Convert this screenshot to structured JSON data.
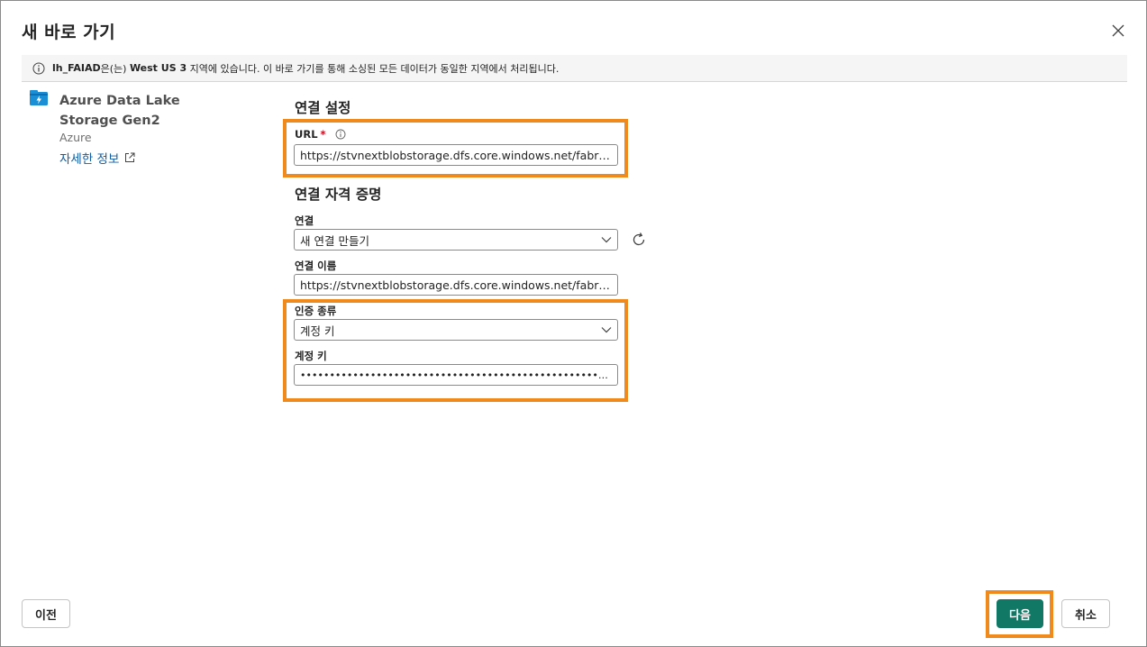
{
  "dialog": {
    "title": "새 바로 가기",
    "close_icon": "close-icon"
  },
  "info_bar": {
    "lakehouse": "lh_FAIAD",
    "text_1": "은(는) ",
    "region": "West US 3",
    "text_2": " 지역에 있습니다. 이 바로 가기를 통해 소싱된 모든 데이터가 동일한 지역에서 처리됩니다."
  },
  "source": {
    "name": "Azure Data Lake Storage Gen2",
    "category": "Azure",
    "learn_more": "자세한 정보",
    "icon": "storage-icon"
  },
  "connection_settings": {
    "title": "연결 설정",
    "url_label": "URL",
    "url_required": "*",
    "url_value": "https://stvnextblobstorage.dfs.core.windows.net/fabrikam-..."
  },
  "credentials": {
    "title": "연결 자격 증명",
    "connection_label": "연결",
    "connection_value": "새 연결 만들기",
    "connection_name_label": "연결 이름",
    "connection_name_value": "https://stvnextblobstorage.dfs.core.windows.net/fabrikam-...",
    "auth_kind_label": "인증 종류",
    "auth_kind_value": "계정 키",
    "account_key_label": "계정 키",
    "account_key_value": "••••••••••••••••••••••••••••••••••••••••••••••••••••••••••••••..."
  },
  "footer": {
    "back_label": "이전",
    "next_label": "다음",
    "cancel_label": "취소"
  },
  "colors": {
    "primary": "#117865",
    "highlight": "#f08a1c",
    "link": "#115ea3"
  }
}
